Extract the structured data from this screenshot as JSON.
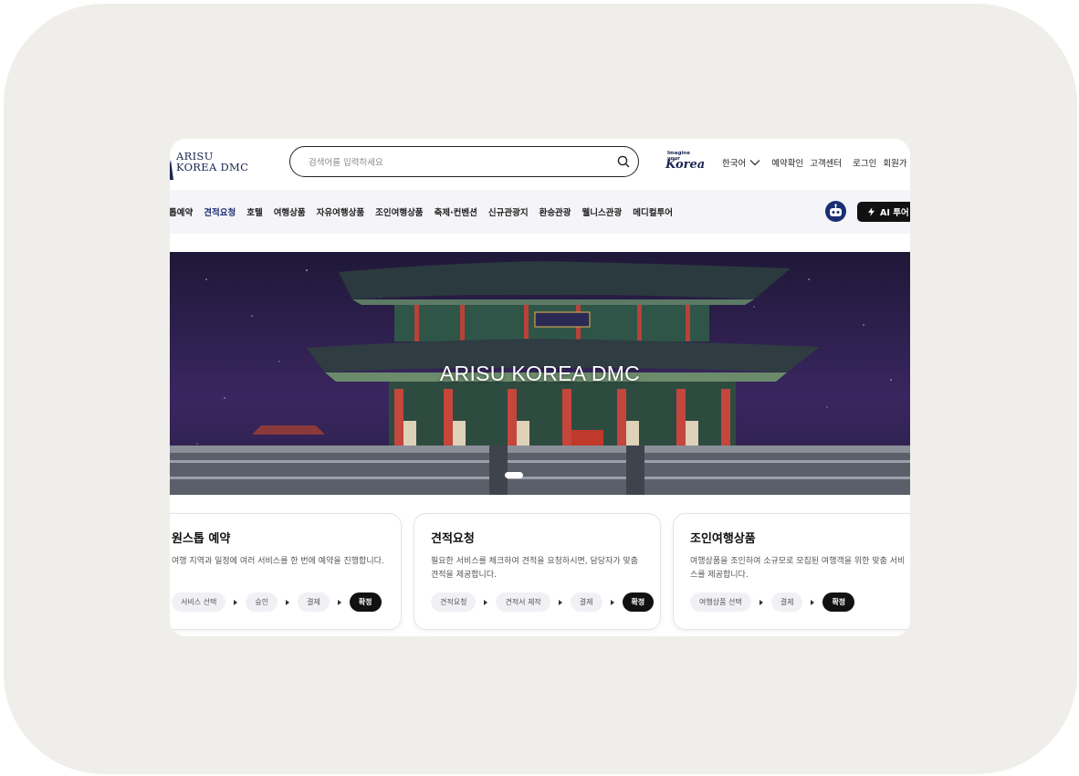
{
  "logo": {
    "line1": "ARISU",
    "line2": "KOREA DMC"
  },
  "search": {
    "placeholder": "검색어를 입력하세요",
    "value": ""
  },
  "imagine_logo": {
    "small": "Imagine your",
    "big": "Korea"
  },
  "top_links": {
    "language": "한국어",
    "booking_check": "예약확인",
    "customer_center": "고객센터",
    "login": "로그인",
    "signup": "회원가"
  },
  "nav": {
    "items": [
      "톱예약",
      "견적요청",
      "호텔",
      "여행상품",
      "자유여행상품",
      "조인여행상품",
      "축제·컨벤션",
      "신규관광지",
      "환승관광",
      "웰니스관광",
      "메디컬투어"
    ],
    "active_index": 1,
    "ai_button": "AI 투어"
  },
  "hero": {
    "title": "ARISU KOREA DMC"
  },
  "cards": [
    {
      "title": "원스톱 예약",
      "desc": "여행 지역과 일정에 여러 서비스를 한 번에 예약을 진행합니다.",
      "steps": [
        "서비스 선택",
        "승인",
        "결제",
        "확정"
      ]
    },
    {
      "title": "견적요청",
      "desc": "필요한 서비스를 체크하여 견적을 요청하시면, 담당자가 맞춤 견적을 제공합니다.",
      "steps": [
        "견적요청",
        "견적서 제작",
        "결제",
        "확정"
      ]
    },
    {
      "title": "조인여행상품",
      "desc": "여행상품을 조인하여 소규모로 모집된 여행객을 위한 맞춤 서비스를 제공합니다.",
      "steps": [
        "여행상품 선택",
        "결제",
        "확정"
      ]
    }
  ],
  "colors": {
    "brand_navy": "#1b2e73",
    "outer_bg": "#efeeea",
    "nav_bg": "#f5f5f9"
  }
}
